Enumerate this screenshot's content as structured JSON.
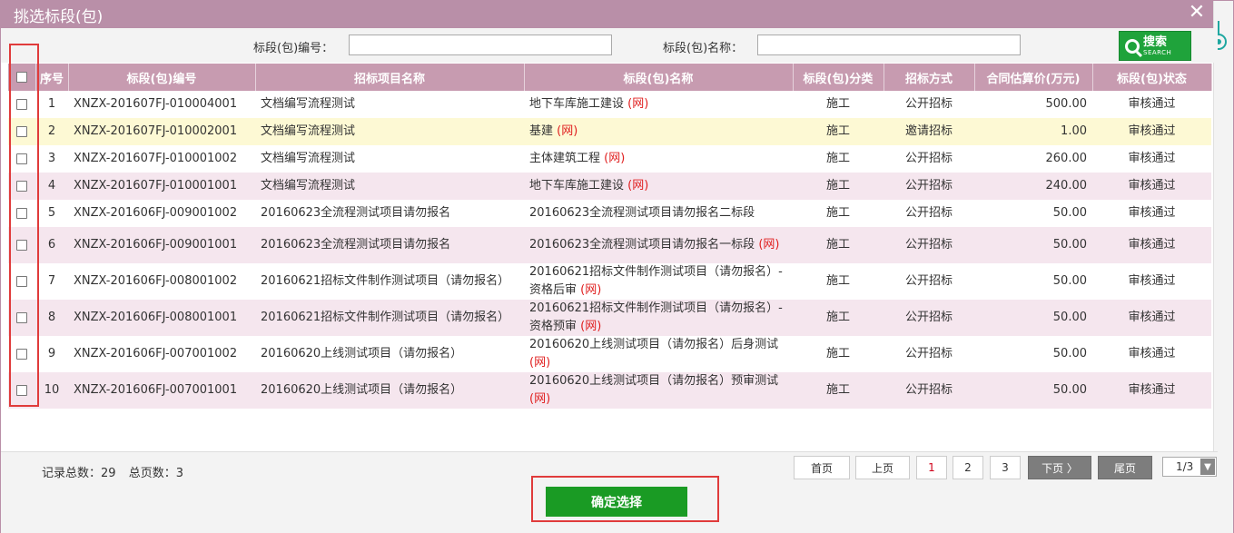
{
  "window": {
    "title": "挑选标段(包)"
  },
  "search": {
    "code_label": "标段(包)编号：",
    "code_value": "",
    "name_label": "标段(包)名称：",
    "name_value": "",
    "button_cn": "搜索",
    "button_en": "SEARCH"
  },
  "table": {
    "columns": [
      "序号",
      "标段(包)编号",
      "招标项目名称",
      "标段(包)名称",
      "标段(包)分类",
      "招标方式",
      "合同估算价(万元)",
      "标段(包)状态"
    ],
    "network_tag": "(网)",
    "rows": [
      {
        "no": "1",
        "code": "XNZX-201607FJ-010004001",
        "project": "文档编写流程测试",
        "section": "地下车库施工建设",
        "net": true,
        "type": "施工",
        "method": "公开招标",
        "price": "500.00",
        "status": "审核通过"
      },
      {
        "no": "2",
        "code": "XNZX-201607FJ-010002001",
        "project": "文档编写流程测试",
        "section": "基建",
        "net": true,
        "type": "施工",
        "method": "邀请招标",
        "price": "1.00",
        "status": "审核通过"
      },
      {
        "no": "3",
        "code": "XNZX-201607FJ-010001002",
        "project": "文档编写流程测试",
        "section": "主体建筑工程",
        "net": true,
        "type": "施工",
        "method": "公开招标",
        "price": "260.00",
        "status": "审核通过"
      },
      {
        "no": "4",
        "code": "XNZX-201607FJ-010001001",
        "project": "文档编写流程测试",
        "section": "地下车库施工建设",
        "net": true,
        "type": "施工",
        "method": "公开招标",
        "price": "240.00",
        "status": "审核通过"
      },
      {
        "no": "5",
        "code": "XNZX-201606FJ-009001002",
        "project": "20160623全流程测试项目请勿报名",
        "section": "20160623全流程测试项目请勿报名二标段",
        "net": false,
        "type": "施工",
        "method": "公开招标",
        "price": "50.00",
        "status": "审核通过"
      },
      {
        "no": "6",
        "code": "XNZX-201606FJ-009001001",
        "project": "20160623全流程测试项目请勿报名",
        "section": "20160623全流程测试项目请勿报名一标段",
        "net": true,
        "type": "施工",
        "method": "公开招标",
        "price": "50.00",
        "status": "审核通过"
      },
      {
        "no": "7",
        "code": "XNZX-201606FJ-008001002",
        "project": "20160621招标文件制作测试项目（请勿报名）",
        "section": "20160621招标文件制作测试项目（请勿报名）-资格后审",
        "net": true,
        "type": "施工",
        "method": "公开招标",
        "price": "50.00",
        "status": "审核通过"
      },
      {
        "no": "8",
        "code": "XNZX-201606FJ-008001001",
        "project": "20160621招标文件制作测试项目（请勿报名）",
        "section": "20160621招标文件制作测试项目（请勿报名）-资格预审",
        "net": true,
        "type": "施工",
        "method": "公开招标",
        "price": "50.00",
        "status": "审核通过"
      },
      {
        "no": "9",
        "code": "XNZX-201606FJ-007001002",
        "project": "20160620上线测试项目（请勿报名）",
        "section": "20160620上线测试项目（请勿报名）后身测试",
        "net": true,
        "type": "施工",
        "method": "公开招标",
        "price": "50.00",
        "status": "审核通过"
      },
      {
        "no": "10",
        "code": "XNZX-201606FJ-007001001",
        "project": "20160620上线测试项目（请勿报名）",
        "section": "20160620上线测试项目（请勿报名）预审测试",
        "net": true,
        "type": "施工",
        "method": "公开招标",
        "price": "50.00",
        "status": "审核通过"
      }
    ]
  },
  "footer": {
    "record_total": "记录总数：29",
    "page_total": "总页数：3",
    "first": "首页",
    "prev": "上页",
    "pages": [
      "1",
      "2",
      "3"
    ],
    "current_page": "1",
    "next": "下页 〉",
    "last": "尾页",
    "page_select": "1/3",
    "confirm": "确定选择"
  },
  "colors": {
    "title_bar": "#b98fa8",
    "header_row": "#c79bb0",
    "alt_row": "#f5e6ee",
    "highlight_row": "#fdf9d4",
    "network_tag": "#e02020",
    "confirm_button": "#1a9b24",
    "annotation_box": "#e03b3b"
  }
}
